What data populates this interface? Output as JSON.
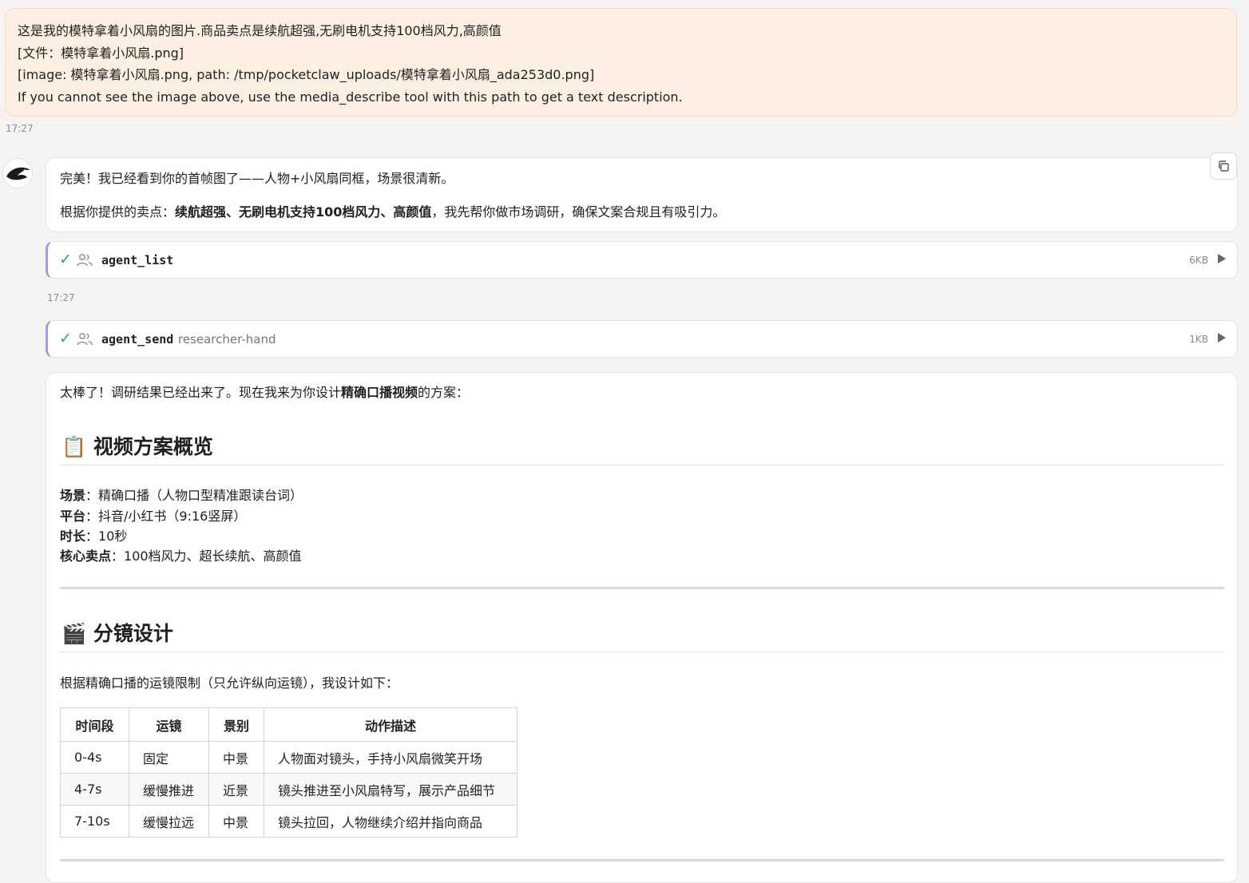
{
  "user_message": {
    "lines": [
      "这是我的模特拿着小风扇的图片.商品卖点是续航超强,无刷电机支持100档风力,高颜值",
      "[文件：模特拿着小风扇.png]",
      "[image: 模特拿着小风扇.png, path: /tmp/pocketclaw_uploads/模特拿着小风扇_ada253d0.png]",
      "If you cannot see the image above, use the media_describe tool with this path to get a text description."
    ],
    "timestamp": "17:27"
  },
  "assistant_reply_1": {
    "p1": "完美！我已经看到你的首帧图了——人物+小风扇同框，场景很清新。",
    "p2_prefix": "根据你提供的卖点：",
    "p2_bold": "续航超强、无刷电机支持100档风力、高颜值",
    "p2_suffix": "，我先帮你做市场调研，确保文案合规且有吸引力。",
    "copy_icon": "copy-icon"
  },
  "tool_calls": [
    {
      "status_icon": "check-icon",
      "type_icon": "people-icon",
      "name": "agent_list",
      "arg": "",
      "size": "6KB"
    },
    {
      "status_icon": "check-icon",
      "type_icon": "people-icon",
      "name": "agent_send",
      "arg": "researcher-hand",
      "size": "1KB"
    }
  ],
  "timestamp_2": "17:27",
  "assistant_reply_2": {
    "intro_prefix": "太棒了！调研结果已经出来了。现在我来为你设计",
    "intro_bold": "精确口播视频",
    "intro_suffix": "的方案：",
    "section1": {
      "emoji": "📋",
      "title": "视频方案概览",
      "items": [
        {
          "key": "场景",
          "value": "：精确口播（人物口型精准跟读台词）"
        },
        {
          "key": "平台",
          "value": "：抖音/小红书（9:16竖屏）"
        },
        {
          "key": "时长",
          "value": "：10秒"
        },
        {
          "key": "核心卖点",
          "value": "：100档风力、超长续航、高颜值"
        }
      ]
    },
    "section2": {
      "emoji": "🎬",
      "title": "分镜设计",
      "intro": "根据精确口播的运镜限制（只允许纵向运镜），我设计如下：",
      "table": {
        "headers": [
          "时间段",
          "运镜",
          "景别",
          "动作描述"
        ],
        "rows": [
          [
            "0-4s",
            "固定",
            "中景",
            "人物面对镜头，手持小风扇微笑开场"
          ],
          [
            "4-7s",
            "缓慢推进",
            "近景",
            "镜头推进至小风扇特写，展示产品细节"
          ],
          [
            "7-10s",
            "缓慢拉远",
            "中景",
            "镜头拉回，人物继续介绍并指向商品"
          ]
        ]
      }
    }
  }
}
